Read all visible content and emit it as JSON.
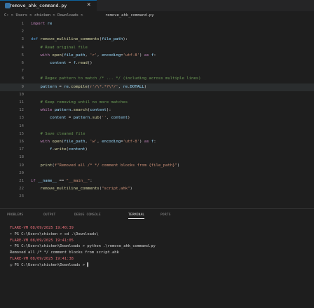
{
  "tab": {
    "name": "remove_ahk_command.py",
    "close": "×"
  },
  "breadcrumbs": [
    "C: > Users > chicken > Downloads >",
    "remove_ahk_command.py"
  ],
  "code": [
    {
      "n": "1",
      "t": "import re"
    },
    {
      "n": "2",
      "t": ""
    },
    {
      "n": "3",
      "t": "def remove_multiline_comments(file_path):"
    },
    {
      "n": "4",
      "t": "    # Read original file"
    },
    {
      "n": "5",
      "t": "    with open(file_path, 'r', encoding='utf-8') as f:"
    },
    {
      "n": "6",
      "t": "        content = f.read()"
    },
    {
      "n": "7",
      "t": ""
    },
    {
      "n": "8",
      "t": "    # Regex pattern to match /* ... */ (including across multiple lines)"
    },
    {
      "n": "9",
      "t": "    pattern = re.compile(r'/\\*.*?\\*/', re.DOTALL)"
    },
    {
      "n": "10",
      "t": ""
    },
    {
      "n": "11",
      "t": "    # Keep removing until no more matches"
    },
    {
      "n": "12",
      "t": "    while pattern.search(content):"
    },
    {
      "n": "13",
      "t": "        content = pattern.sub('', content)"
    },
    {
      "n": "14",
      "t": ""
    },
    {
      "n": "15",
      "t": "    # Save cleaned file"
    },
    {
      "n": "16",
      "t": "    with open(file_path, 'w', encoding='utf-8') as f:"
    },
    {
      "n": "17",
      "t": "        f.write(content)"
    },
    {
      "n": "18",
      "t": ""
    },
    {
      "n": "19",
      "t": "    print(f\"Removed all /* */ comment blocks from {file_path}\")"
    },
    {
      "n": "20",
      "t": ""
    },
    {
      "n": "21",
      "t": "if __name__ == \"__main__\":"
    },
    {
      "n": "22",
      "t": "    remove_multiline_comments(\"script.ahk\")"
    },
    {
      "n": "23",
      "t": ""
    }
  ],
  "panel_tabs": [
    "PROBLEMS",
    "OUTPUT",
    "DEBUG CONSOLE",
    "TERMINAL",
    "PORTS"
  ],
  "terminal": [
    {
      "text": "FLARE-VM 08/09/2025 19:40:39",
      "color": "#e06c75"
    },
    {
      "text": "• PS C:\\Users\\chicken > cd .\\Downloads\\",
      "color": "#d4d4d4"
    },
    {
      "text": "FLARE-VM 08/09/2025 19:41:05",
      "color": "#e06c75"
    },
    {
      "text": "• PS C:\\Users\\chicken\\Downloads > python .\\remove_ahk_command.py",
      "color": "#d4d4d4"
    },
    {
      "text": "Removed all /* */ comment blocks from script.ahk",
      "color": "#d4d4d4"
    },
    {
      "text": "FLARE-VM 08/09/2025 19:41:38",
      "color": "#e06c75"
    },
    {
      "text": "○ PS C:\\Users\\chicken\\Downloads > ▌",
      "color": "#d4d4d4"
    }
  ],
  "colors": {
    "accent": "#0e639c",
    "keyword": "#569cd6",
    "function": "#dcdcaa",
    "string": "#ce9178",
    "comment": "#6a9955"
  }
}
